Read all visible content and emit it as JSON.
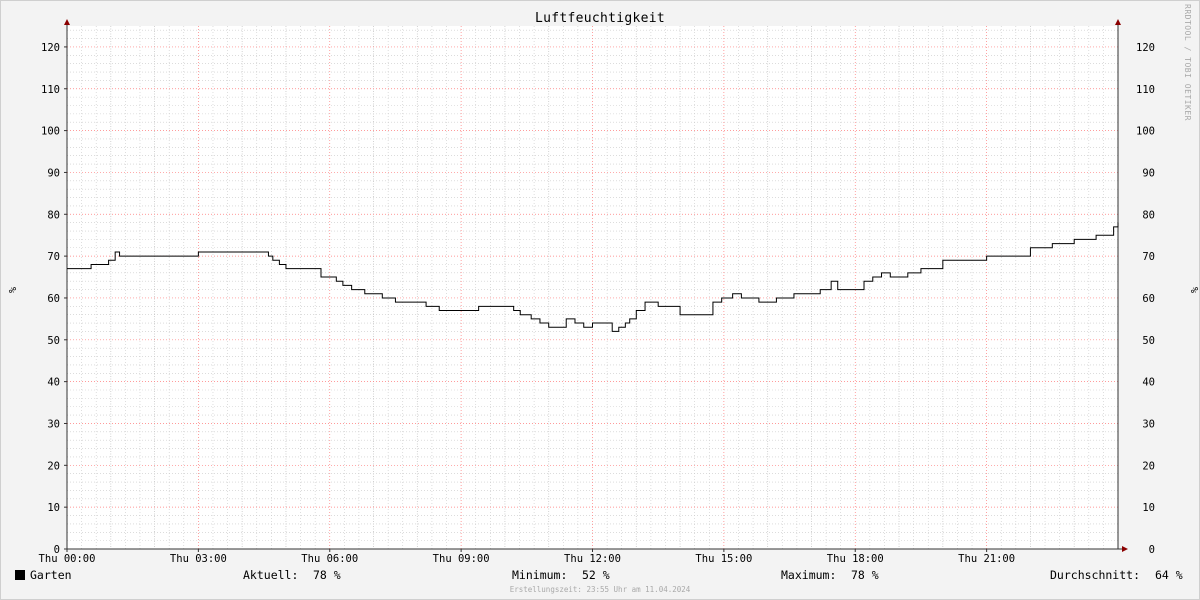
{
  "colors": {
    "background": "#f3f3f3",
    "canvas": "#ffffff",
    "major_grid": "#ff7a7a",
    "minor_grid": "#c8c8c8",
    "axis": "#333333",
    "arrow": "#8b0000",
    "line": "#000000"
  },
  "watermark": "RRDTOOL / TOBI OETIKER",
  "legend": {
    "series_label": "Garten",
    "current_label": "Aktuell:",
    "current_value": "78 %",
    "min_label": "Minimum:",
    "min_value": "52 %",
    "max_label": "Maximum:",
    "max_value": "78 %",
    "avg_label": "Durchschnitt:",
    "avg_value": "64 %"
  },
  "footer": "Erstellungszeit: 23:55 Uhr am 11.04.2024",
  "chart_data": {
    "type": "line",
    "title": "Luftfeuchtigkeit",
    "ylabel": "%",
    "ylabel_right": "%",
    "xlim": [
      0,
      24
    ],
    "ylim": [
      0,
      125
    ],
    "grid": true,
    "legend_position": "bottom",
    "xticks": [
      {
        "x": 0,
        "label": "Thu 00:00"
      },
      {
        "x": 3,
        "label": "Thu 03:00"
      },
      {
        "x": 6,
        "label": "Thu 06:00"
      },
      {
        "x": 9,
        "label": "Thu 09:00"
      },
      {
        "x": 12,
        "label": "Thu 12:00"
      },
      {
        "x": 15,
        "label": "Thu 15:00"
      },
      {
        "x": 18,
        "label": "Thu 18:00"
      },
      {
        "x": 21,
        "label": "Thu 21:00"
      }
    ],
    "yticks": [
      0,
      10,
      20,
      30,
      40,
      50,
      60,
      70,
      80,
      90,
      100,
      110,
      120
    ],
    "series": [
      {
        "name": "Garten",
        "x": [
          0,
          0.25,
          0.55,
          0.95,
          1.1,
          1.2,
          1.55,
          2.0,
          2.5,
          3.0,
          3.5,
          4.0,
          4.5,
          4.6,
          4.7,
          4.85,
          5.0,
          5.5,
          5.8,
          6.0,
          6.15,
          6.3,
          6.5,
          6.8,
          7.0,
          7.2,
          7.3,
          7.5,
          8.0,
          8.2,
          8.5,
          8.8,
          9.0,
          9.4,
          9.6,
          9.9,
          10.2,
          10.35,
          10.6,
          10.8,
          11.0,
          11.4,
          11.6,
          11.8,
          12.0,
          12.35,
          12.45,
          12.6,
          12.75,
          12.85,
          13.0,
          13.2,
          13.5,
          13.7,
          14.0,
          14.55,
          14.75,
          14.95,
          15.2,
          15.4,
          15.8,
          16.2,
          16.4,
          16.6,
          16.8,
          17.2,
          17.45,
          17.6,
          17.8,
          18.0,
          18.2,
          18.4,
          18.6,
          18.8,
          19.0,
          19.2,
          19.5,
          20.0,
          20.5,
          21.0,
          21.5,
          22.0,
          22.5,
          23.0,
          23.5,
          23.9,
          24.0
        ],
        "y": [
          67,
          67,
          68,
          69,
          71,
          70,
          70,
          70,
          70,
          71,
          71,
          71,
          71,
          70,
          69,
          68,
          67,
          67,
          65,
          65,
          64,
          63,
          62,
          61,
          61,
          60,
          60,
          59,
          59,
          58,
          57,
          57,
          57,
          58,
          58,
          58,
          57,
          56,
          55,
          54,
          53,
          55,
          54,
          53,
          54,
          54,
          52,
          53,
          54,
          55,
          57,
          59,
          58,
          58,
          56,
          56,
          59,
          60,
          61,
          60,
          59,
          60,
          60,
          61,
          61,
          62,
          64,
          62,
          62,
          62,
          64,
          65,
          66,
          65,
          65,
          66,
          67,
          69,
          69,
          70,
          70,
          72,
          73,
          74,
          75,
          77,
          78
        ]
      }
    ]
  }
}
